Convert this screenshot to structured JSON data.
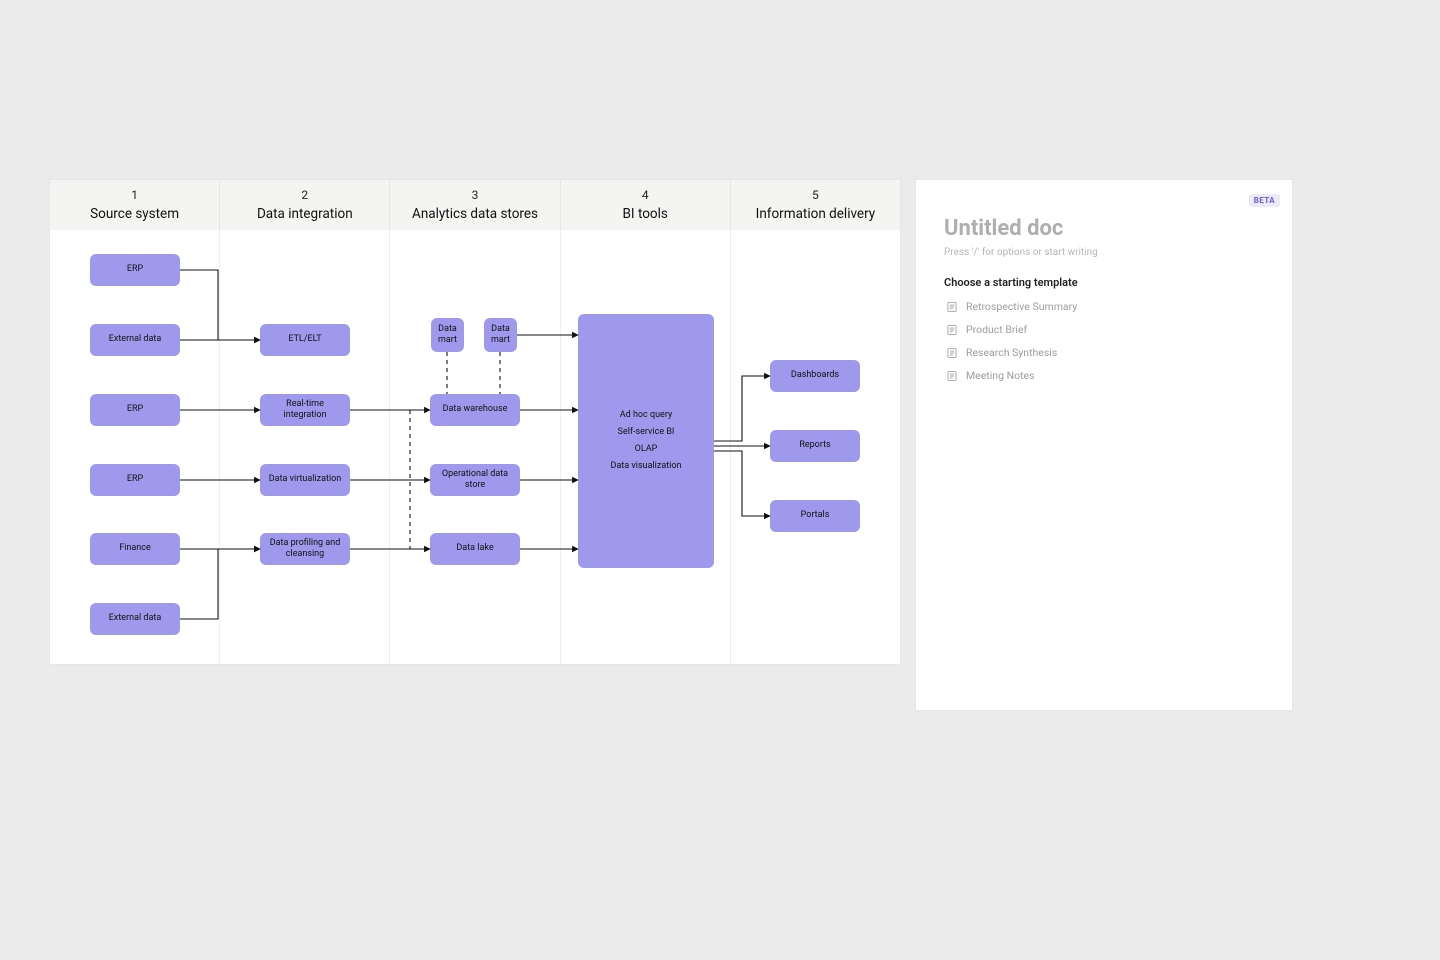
{
  "diagram": {
    "columns": [
      {
        "num": "1",
        "title": "Source system"
      },
      {
        "num": "2",
        "title": "Data integration"
      },
      {
        "num": "3",
        "title": "Analytics data stores"
      },
      {
        "num": "4",
        "title": "BI tools"
      },
      {
        "num": "5",
        "title": "Information delivery"
      }
    ],
    "col1": {
      "erp1": "ERP",
      "external1": "External data",
      "erp2": "ERP",
      "erp3": "ERP",
      "finance": "Finance",
      "external2": "External data"
    },
    "col2": {
      "etl": "ETL/ELT",
      "realtime": "Real-time integration",
      "virtual": "Data virtualization",
      "profiling": "Data profiling and cleansing"
    },
    "col3": {
      "mart1": "Data mart",
      "mart2": "Data mart",
      "warehouse": "Data warehouse",
      "ods": "Operational data store",
      "lake": "Data lake"
    },
    "col4": {
      "adhoc": "Ad hoc query",
      "selfservice": "Self-service BI",
      "olap": "OLAP",
      "viz": "Data visualization"
    },
    "col5": {
      "dashboards": "Dashboards",
      "reports": "Reports",
      "portals": "Portals"
    }
  },
  "doc": {
    "beta": "BETA",
    "title": "Untitled doc",
    "hint": "Press '/' for options or start writing",
    "template_heading": "Choose a starting template",
    "templates": {
      "t1": "Retrospective Summary",
      "t2": "Product Brief",
      "t3": "Research Synthesis",
      "t4": "Meeting Notes"
    }
  }
}
